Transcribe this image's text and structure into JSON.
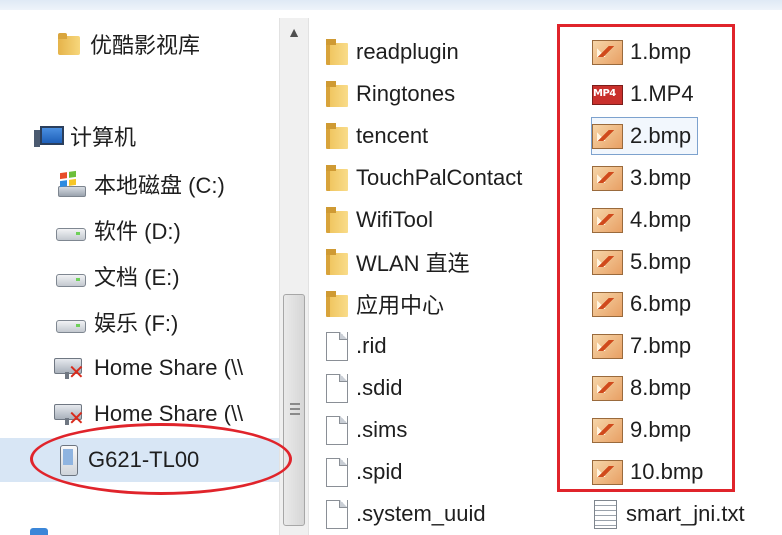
{
  "nav": {
    "items": [
      {
        "label": "优酷影视库",
        "icon": "folder-icon"
      },
      {
        "label": "计算机",
        "icon": "computer-icon"
      },
      {
        "label": "本地磁盘 (C:)",
        "icon": "windows-drive-icon"
      },
      {
        "label": "软件 (D:)",
        "icon": "drive-icon"
      },
      {
        "label": "文档 (E:)",
        "icon": "drive-icon"
      },
      {
        "label": "娱乐 (F:)",
        "icon": "drive-icon"
      },
      {
        "label": "Home Share (\\\\",
        "icon": "network-share-disconnected-icon"
      },
      {
        "label": "Home Share (\\\\",
        "icon": "network-share-disconnected-icon"
      },
      {
        "label": "G621-TL00",
        "icon": "phone-icon"
      }
    ],
    "scroll_up_glyph": "▲"
  },
  "files": {
    "column1": [
      {
        "name": "readplugin",
        "type": "folder"
      },
      {
        "name": "Ringtones",
        "type": "folder"
      },
      {
        "name": "tencent",
        "type": "folder"
      },
      {
        "name": "TouchPalContact",
        "type": "folder"
      },
      {
        "name": "WifiTool",
        "type": "folder"
      },
      {
        "name": "WLAN 直连",
        "type": "folder"
      },
      {
        "name": "应用中心",
        "type": "folder"
      },
      {
        "name": ".rid",
        "type": "file"
      },
      {
        "name": ".sdid",
        "type": "file"
      },
      {
        "name": ".sims",
        "type": "file"
      },
      {
        "name": ".spid",
        "type": "file"
      },
      {
        "name": ".system_uuid",
        "type": "file"
      }
    ],
    "column2": [
      {
        "name": "1.bmp",
        "type": "bmp"
      },
      {
        "name": "1.MP4",
        "type": "mp4",
        "icon_text": "MP4"
      },
      {
        "name": "2.bmp",
        "type": "bmp",
        "focused": true
      },
      {
        "name": "3.bmp",
        "type": "bmp"
      },
      {
        "name": "4.bmp",
        "type": "bmp"
      },
      {
        "name": "5.bmp",
        "type": "bmp"
      },
      {
        "name": "6.bmp",
        "type": "bmp"
      },
      {
        "name": "7.bmp",
        "type": "bmp"
      },
      {
        "name": "8.bmp",
        "type": "bmp"
      },
      {
        "name": "9.bmp",
        "type": "bmp"
      },
      {
        "name": "10.bmp",
        "type": "bmp"
      },
      {
        "name": "smart_jni.txt",
        "type": "txt"
      }
    ]
  },
  "colors": {
    "annotation_red": "#e0242b",
    "selection_blue": "#d8e6f5"
  }
}
